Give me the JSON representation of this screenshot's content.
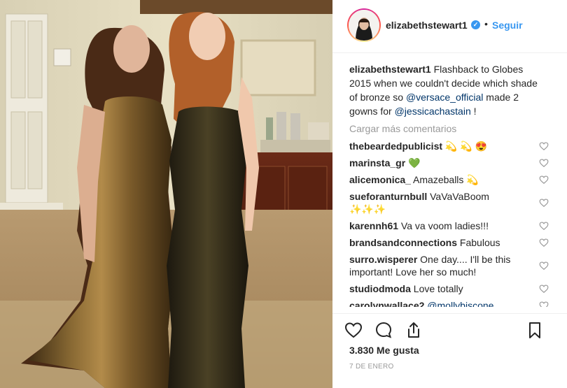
{
  "post": {
    "username": "elizabethstewart1",
    "follow_label": "Seguir",
    "verified_mark": "✓",
    "separator": "•"
  },
  "caption": {
    "username": "elizabethstewart1",
    "text_1": " Flashback to Globes 2015 when we couldn't decide which shade of bronze so ",
    "mention_1": "@versace_official",
    "text_2": " made 2 gowns for ",
    "mention_2": "@jessicachastain",
    "text_3": " !"
  },
  "load_more_label": "Cargar más comentarios",
  "comments": [
    {
      "user": "thebeardedpublicist",
      "text": " 💫 💫 😍"
    },
    {
      "user": "marinsta_gr",
      "text": " 💚"
    },
    {
      "user": "alicemonica_",
      "text": " Amazeballs 💫"
    },
    {
      "user": "sueforanturnbull",
      "text": " VaVaVaBoom ✨✨✨"
    },
    {
      "user": "karennh61",
      "text": " Va va voom ladies!!!"
    },
    {
      "user": "brandsandconnections",
      "text": " Fabulous"
    },
    {
      "user": "surro.wisperer",
      "text": " One day.... I'll be this important! Love her so much!"
    },
    {
      "user": "studiodmoda",
      "text": " Love totally"
    },
    {
      "user": "carolynwallace2",
      "text": " ",
      "mention": "@mollybiscone"
    }
  ],
  "likes_label": "3.830 Me gusta",
  "date_label": "7 DE ENERO",
  "icons": {
    "like": "heart-icon",
    "comment": "comment-icon",
    "share": "share-icon",
    "save": "bookmark-icon",
    "verified": "verified-badge-icon"
  },
  "colors": {
    "link_blue": "#3897f0",
    "mention_blue": "#003569",
    "muted_gray": "#999999",
    "text": "#262626",
    "divider": "#efefef"
  }
}
